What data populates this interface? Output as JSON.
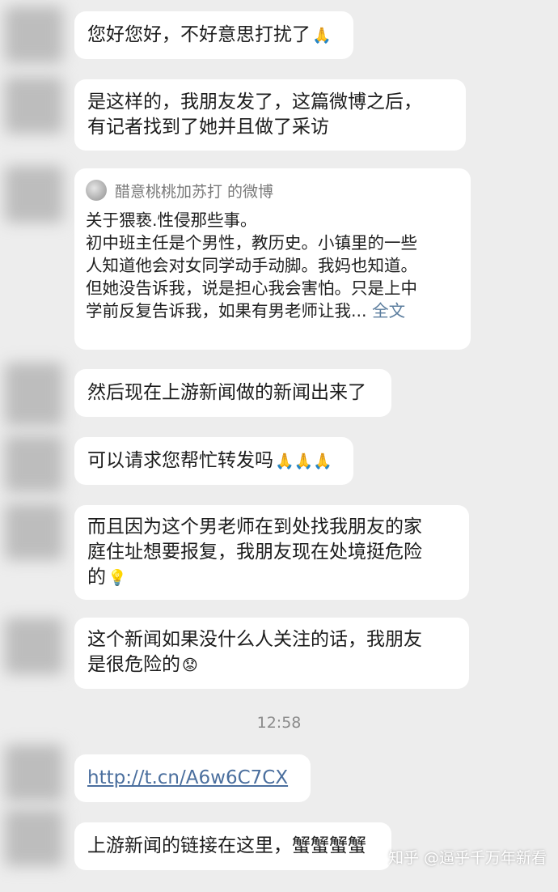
{
  "messages": {
    "m1": "您好您好，不好意思打扰了",
    "m2": "是这样的，我朋友发了，这篇微博之后，\n有记者找到了她并且做了采访",
    "m3": "然后现在上游新闻做的新闻出来了",
    "m4": "可以请求您帮忙转发吗",
    "m5": "而且因为这个男老师在到处找我朋友的家\n庭住址想要报复，我朋友现在处境挺危险\n的",
    "m6": "这个新闻如果没什么人关注的话，我朋友\n是很危险的",
    "m7_link": "http://t.cn/A6w6C7CX",
    "m8": "上游新闻的链接在这里，蟹蟹蟹蟹"
  },
  "emoji": {
    "pray": "🙏",
    "pray_triple": "🙏🙏🙏",
    "bulb": "💡",
    "worried": "😟"
  },
  "quote": {
    "source": "醋意桃桃加苏打 的微博",
    "body": "关于猥亵.性侵那些事。\n初中班主任是个男性，教历史。小镇里的一些\n人知道他会对女同学动手动脚。我妈也知道。\n但她没告诉我，说是担心我会害怕。只是上中\n学前反复告诉我，如果有男老师让我...",
    "more": "全文"
  },
  "timestamp": "12:58",
  "watermark": "知乎 @逼乎千万年新看"
}
